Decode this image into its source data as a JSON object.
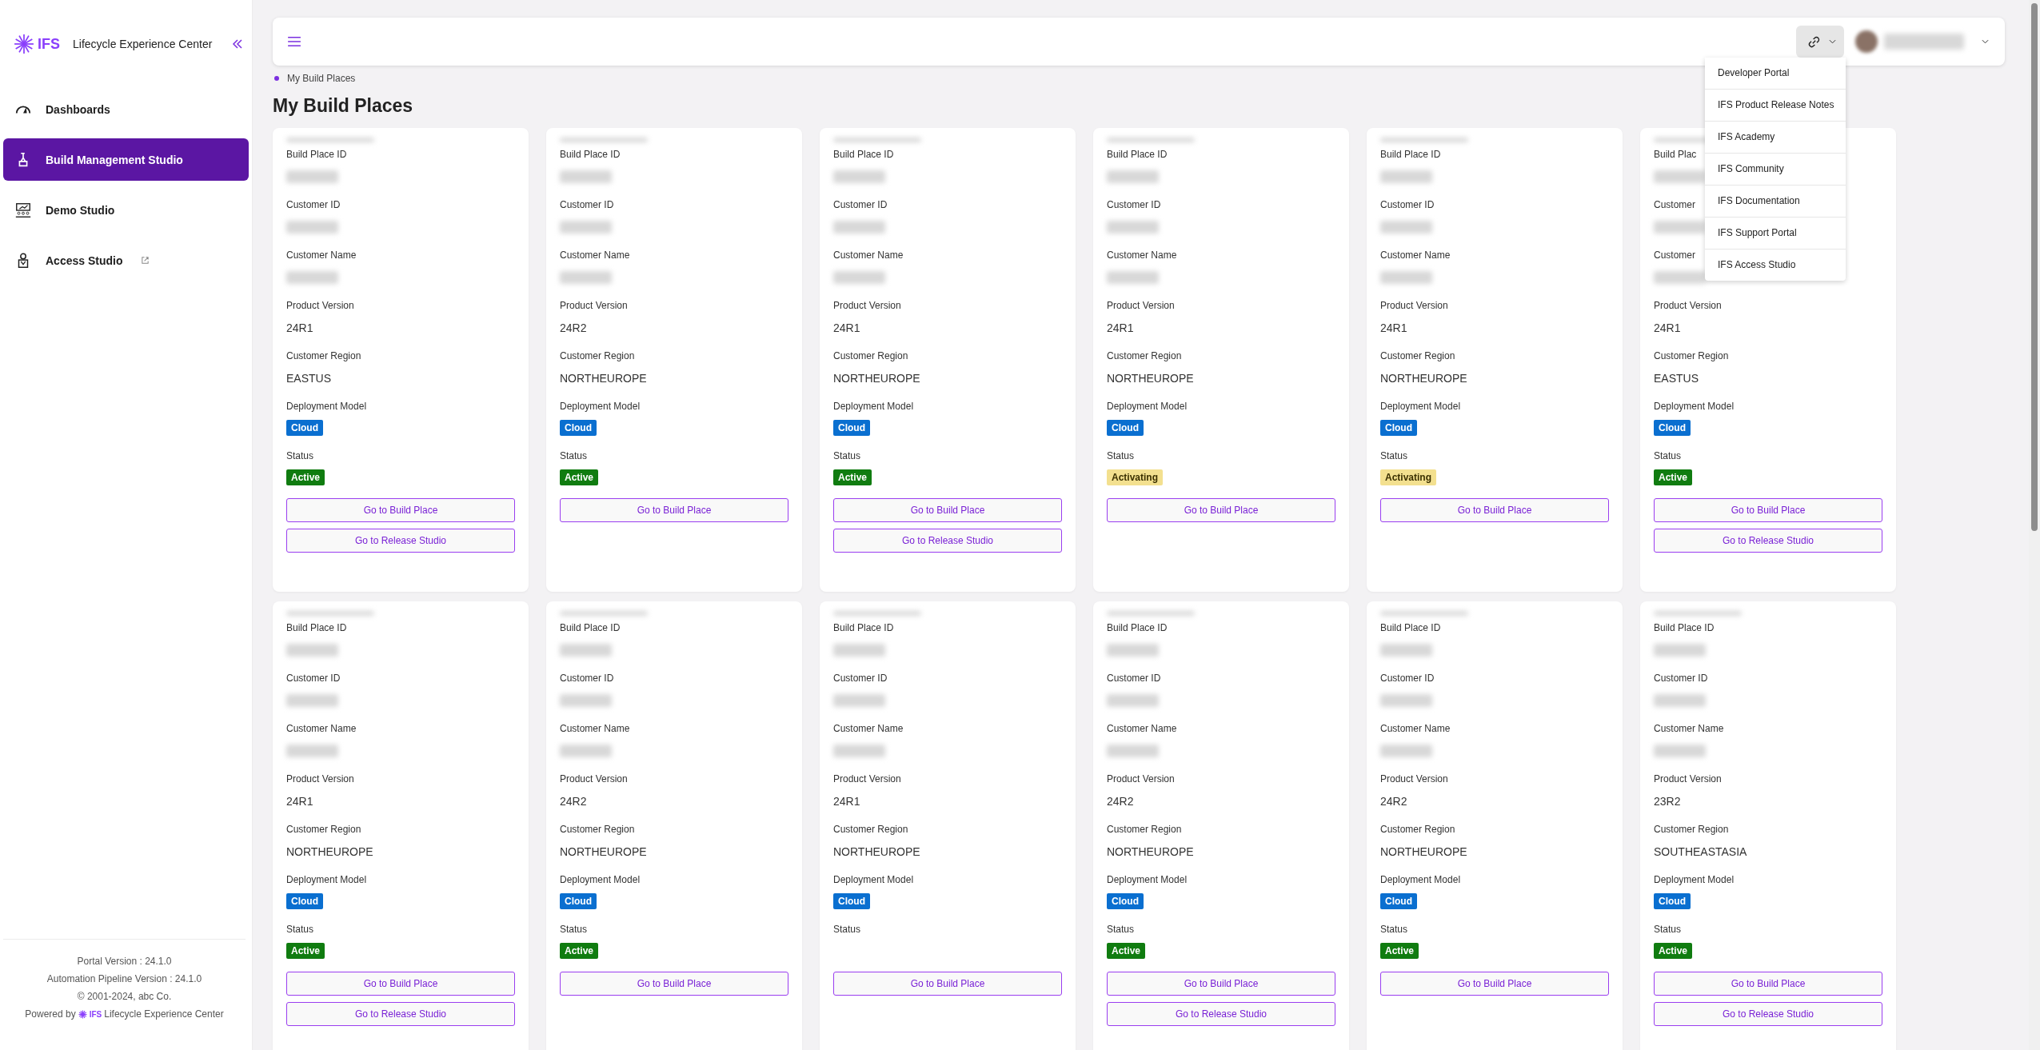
{
  "sidebar": {
    "brand": "IFS",
    "app_title": "Lifecycle Experience Center",
    "items": [
      {
        "label": "Dashboards",
        "selected": false,
        "external": false
      },
      {
        "label": "Build Management Studio",
        "selected": true,
        "external": false
      },
      {
        "label": "Demo Studio",
        "selected": false,
        "external": false
      },
      {
        "label": "Access Studio",
        "selected": false,
        "external": true
      }
    ],
    "footer": {
      "portal_version": "Portal Version : 24.1.0",
      "pipeline_version": "Automation Pipeline Version : 24.1.0",
      "copyright": "© 2001-2024, abc Co.",
      "powered_by": "Powered by",
      "powered_brand": "IFS",
      "powered_product": "Lifecycle Experience Center"
    }
  },
  "header": {
    "links_menu_expanded": true,
    "links_menu": [
      "Developer Portal",
      "IFS Product Release Notes",
      "IFS Academy",
      "IFS Community",
      "IFS Documentation",
      "IFS Support Portal",
      "IFS Access Studio"
    ]
  },
  "breadcrumb": [
    "My Build Places"
  ],
  "page_title": "My Build Places",
  "cards": [
    {
      "fields": [
        {
          "label": "Build Place ID"
        },
        {
          "label": "Customer ID"
        },
        {
          "label": "Customer Name"
        },
        {
          "label": "Product Version",
          "value": "24R1"
        },
        {
          "label": "Customer Region",
          "value": "EASTUS"
        }
      ],
      "deployment_label": "Deployment Model",
      "deployment": "Cloud",
      "status_label": "Status",
      "status": {
        "text": "Active",
        "color": "#107c10"
      },
      "buttons": [
        "Go to Build Place",
        "Go to Release Studio"
      ]
    },
    {
      "fields": [
        {
          "label": "Build Place ID"
        },
        {
          "label": "Customer ID"
        },
        {
          "label": "Customer Name"
        },
        {
          "label": "Product Version",
          "value": "24R2"
        },
        {
          "label": "Customer Region",
          "value": "NORTHEUROPE"
        }
      ],
      "deployment_label": "Deployment Model",
      "deployment": "Cloud",
      "status_label": "Status",
      "status": {
        "text": "Active",
        "color": "#107c10"
      },
      "buttons": [
        "Go to Build Place"
      ]
    },
    {
      "fields": [
        {
          "label": "Build Place ID"
        },
        {
          "label": "Customer ID"
        },
        {
          "label": "Customer Name"
        },
        {
          "label": "Product Version",
          "value": "24R1"
        },
        {
          "label": "Customer Region",
          "value": "NORTHEUROPE"
        }
      ],
      "deployment_label": "Deployment Model",
      "deployment": "Cloud",
      "status_label": "Status",
      "status": {
        "text": "Active",
        "color": "#107c10"
      },
      "buttons": [
        "Go to Build Place",
        "Go to Release Studio"
      ]
    },
    {
      "fields": [
        {
          "label": "Build Place ID"
        },
        {
          "label": "Customer ID"
        },
        {
          "label": "Customer Name"
        },
        {
          "label": "Product Version",
          "value": "24R1"
        },
        {
          "label": "Customer Region",
          "value": "NORTHEUROPE"
        }
      ],
      "deployment_label": "Deployment Model",
      "deployment": "Cloud",
      "status_label": "Status",
      "status": {
        "text": "Activating",
        "color": "#f3e08f"
      },
      "buttons": [
        "Go to Build Place"
      ]
    },
    {
      "fields": [
        {
          "label": "Build Place ID"
        },
        {
          "label": "Customer ID"
        },
        {
          "label": "Customer Name"
        },
        {
          "label": "Product Version",
          "value": "24R1"
        },
        {
          "label": "Customer Region",
          "value": "NORTHEUROPE"
        }
      ],
      "deployment_label": "Deployment Model",
      "deployment": "Cloud",
      "status_label": "Status",
      "status": {
        "text": "Activating",
        "color": "#f3e08f"
      },
      "buttons": [
        "Go to Build Place"
      ]
    },
    {
      "fields": [
        {
          "label": "Build Plac"
        },
        {
          "label": "Customer"
        },
        {
          "label": "Customer"
        },
        {
          "label": "Product Version",
          "value": "24R1"
        },
        {
          "label": "Customer Region",
          "value": "EASTUS"
        }
      ],
      "deployment_label": "Deployment Model",
      "deployment": "Cloud",
      "status_label": "Status",
      "status": {
        "text": "Active",
        "color": "#107c10"
      },
      "buttons": [
        "Go to Build Place",
        "Go to Release Studio"
      ]
    },
    {
      "fields": [
        {
          "label": "Build Place ID"
        },
        {
          "label": "Customer ID"
        },
        {
          "label": "Customer Name"
        },
        {
          "label": "Product Version",
          "value": "24R1"
        },
        {
          "label": "Customer Region",
          "value": "NORTHEUROPE"
        }
      ],
      "deployment_label": "Deployment Model",
      "deployment": "Cloud",
      "status_label": "Status",
      "status": {
        "text": "Active",
        "color": "#107c10"
      },
      "buttons": [
        "Go to Build Place",
        "Go to Release Studio"
      ]
    },
    {
      "fields": [
        {
          "label": "Build Place ID"
        },
        {
          "label": "Customer ID"
        },
        {
          "label": "Customer Name"
        },
        {
          "label": "Product Version",
          "value": "24R2"
        },
        {
          "label": "Customer Region",
          "value": "NORTHEUROPE"
        }
      ],
      "deployment_label": "Deployment Model",
      "deployment": "Cloud",
      "status_label": "Status",
      "status": {
        "text": "Active",
        "color": "#107c10"
      },
      "buttons": [
        "Go to Build Place"
      ]
    },
    {
      "fields": [
        {
          "label": "Build Place ID"
        },
        {
          "label": "Customer ID"
        },
        {
          "label": "Customer Name"
        },
        {
          "label": "Product Version",
          "value": "24R1"
        },
        {
          "label": "Customer Region",
          "value": "NORTHEUROPE"
        }
      ],
      "deployment_label": "Deployment Model",
      "deployment": "Cloud",
      "status_label": "Status",
      "buttons": [
        "Go to Build Place"
      ]
    },
    {
      "fields": [
        {
          "label": "Build Place ID"
        },
        {
          "label": "Customer ID"
        },
        {
          "label": "Customer Name"
        },
        {
          "label": "Product Version",
          "value": "24R2"
        },
        {
          "label": "Customer Region",
          "value": "NORTHEUROPE"
        }
      ],
      "deployment_label": "Deployment Model",
      "deployment": "Cloud",
      "status_label": "Status",
      "status": {
        "text": "Active",
        "color": "#107c10"
      },
      "buttons": [
        "Go to Build Place",
        "Go to Release Studio"
      ]
    },
    {
      "fields": [
        {
          "label": "Build Place ID"
        },
        {
          "label": "Customer ID"
        },
        {
          "label": "Customer Name"
        },
        {
          "label": "Product Version",
          "value": "24R2"
        },
        {
          "label": "Customer Region",
          "value": "NORTHEUROPE"
        }
      ],
      "deployment_label": "Deployment Model",
      "deployment": "Cloud",
      "status_label": "Status",
      "status": {
        "text": "Active",
        "color": "#107c10"
      },
      "buttons": [
        "Go to Build Place"
      ]
    },
    {
      "fields": [
        {
          "label": "Build Place ID"
        },
        {
          "label": "Customer ID"
        },
        {
          "label": "Customer Name"
        },
        {
          "label": "Product Version",
          "value": "23R2"
        },
        {
          "label": "Customer Region",
          "value": "SOUTHEASTASIA"
        }
      ],
      "deployment_label": "Deployment Model",
      "deployment": "Cloud",
      "status_label": "Status",
      "status": {
        "text": "Active",
        "color": "#107c10"
      },
      "buttons": [
        "Go to Build Place",
        "Go to Release Studio"
      ]
    }
  ]
}
